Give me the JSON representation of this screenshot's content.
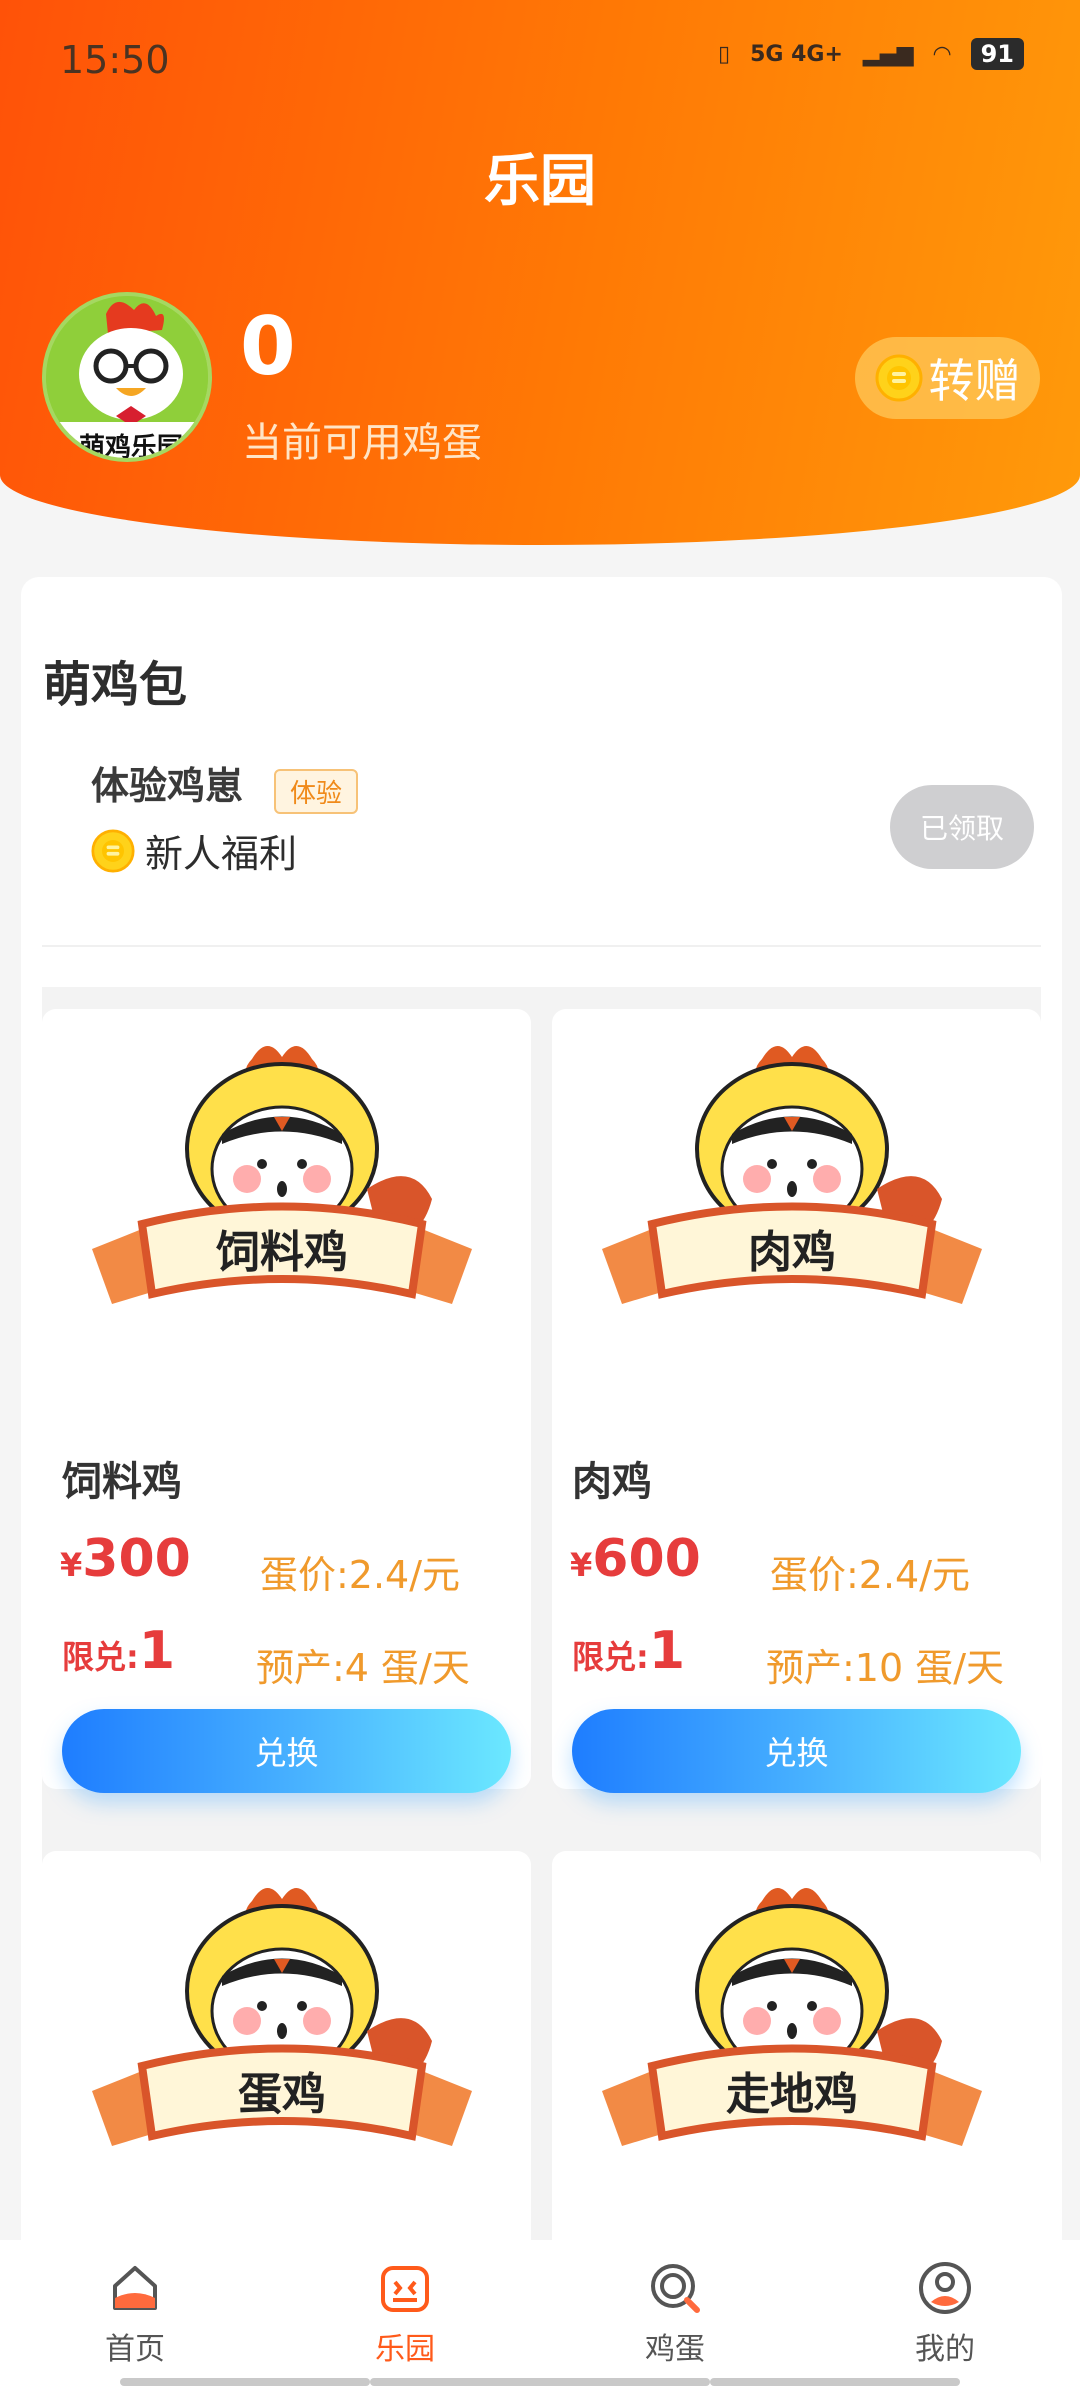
{
  "status": {
    "time": "15:50",
    "network": "5G 4G+",
    "battery": "91"
  },
  "header": {
    "title": "乐园",
    "avatar_text": "萌鸡乐园",
    "eggs_count": "0",
    "eggs_label": "当前可用鸡蛋",
    "gift_label": "转赠"
  },
  "section": {
    "title": "萌鸡包",
    "trial": {
      "name": "体验鸡崽",
      "tag": "体验",
      "benefit": "新人福利",
      "button": "已领取"
    }
  },
  "products": [
    {
      "image_label": "饲料鸡",
      "name": "饲料鸡",
      "currency": "¥",
      "price": "300",
      "egg_price": "蛋价:2.4/元",
      "limit_label": "限兑:",
      "limit": "1",
      "yield": "预产:4 蛋/天",
      "button": "兑换"
    },
    {
      "image_label": "肉鸡",
      "name": "肉鸡",
      "currency": "¥",
      "price": "600",
      "egg_price": "蛋价:2.4/元",
      "limit_label": "限兑:",
      "limit": "1",
      "yield": "预产:10 蛋/天",
      "button": "兑换"
    },
    {
      "image_label": "蛋鸡"
    },
    {
      "image_label": "走地鸡"
    }
  ],
  "nav": [
    {
      "label": "首页",
      "icon": "home-icon"
    },
    {
      "label": "乐园",
      "icon": "park-icon"
    },
    {
      "label": "鸡蛋",
      "icon": "egg-search-icon"
    },
    {
      "label": "我的",
      "icon": "profile-icon"
    }
  ],
  "colors": {
    "header_start": "#ff5208",
    "header_end": "#ff9a0a",
    "price_red": "#e63c3c",
    "egg_orange": "#f09a2c",
    "active_nav": "#ff5a1a",
    "button_blue_start": "#1e7dff",
    "button_blue_end": "#6be8ff"
  }
}
